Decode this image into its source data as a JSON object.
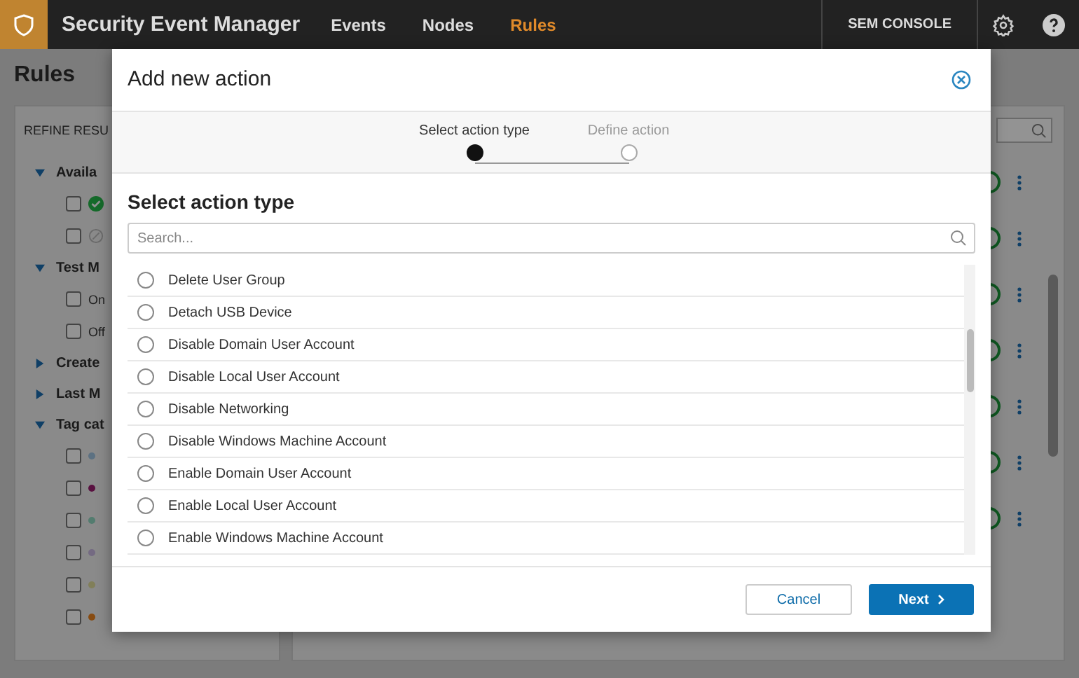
{
  "app_bar": {
    "title": "Security Event Manager",
    "nav": [
      {
        "label": "Events",
        "selected": false
      },
      {
        "label": "Nodes",
        "selected": false
      },
      {
        "label": "Rules",
        "selected": true
      }
    ],
    "console": "SEM CONSOLE"
  },
  "page": {
    "title": "Rules",
    "refine": "REFINE RESU",
    "groups": [
      {
        "label": "Availa",
        "expanded": true,
        "options": [
          {
            "kind": "status-ok",
            "checked": false
          },
          {
            "kind": "status-off",
            "checked": false
          }
        ]
      },
      {
        "label": "Test M",
        "expanded": true,
        "options": [
          {
            "label": "On",
            "kind": "plain",
            "checked": false
          },
          {
            "label": "Off",
            "kind": "plain",
            "checked": false
          }
        ]
      },
      {
        "label": "Create",
        "expanded": false
      },
      {
        "label": "Last M",
        "expanded": false
      },
      {
        "label": "Tag cat",
        "expanded": true,
        "options": [
          {
            "kind": "tag",
            "color": "#5c7182",
            "checked": false
          },
          {
            "kind": "tag",
            "color": "#591140",
            "checked": false
          },
          {
            "kind": "tag",
            "color": "#537c6f",
            "checked": false
          },
          {
            "kind": "tag",
            "color": "#746a82",
            "checked": false
          },
          {
            "kind": "tag",
            "color": "#817f59",
            "checked": false
          },
          {
            "kind": "tag",
            "color": "#874b11",
            "checked": false
          }
        ]
      }
    ],
    "rules": [
      {
        "on": true
      },
      {
        "on": true
      },
      {
        "on": true
      },
      {
        "on": true
      },
      {
        "on": true
      },
      {
        "on": true
      },
      {
        "on": true
      }
    ]
  },
  "dialog": {
    "title": "Add new action",
    "steps": [
      {
        "label": "Select action type",
        "selected": true
      },
      {
        "label": "Define action",
        "selected": false
      }
    ],
    "heading": "Select action type",
    "search": {
      "placeholder": "Search..."
    },
    "options": [
      {
        "label": "Delete User Group",
        "selected": false
      },
      {
        "label": "Detach USB Device",
        "selected": false
      },
      {
        "label": "Disable Domain User Account",
        "selected": false
      },
      {
        "label": "Disable Local User Account",
        "selected": false
      },
      {
        "label": "Disable Networking",
        "selected": false
      },
      {
        "label": "Disable Windows Machine Account",
        "selected": false
      },
      {
        "label": "Enable Domain User Account",
        "selected": false
      },
      {
        "label": "Enable Local User Account",
        "selected": false
      },
      {
        "label": "Enable Windows Machine Account",
        "selected": false
      }
    ],
    "buttons": {
      "cancel": "Cancel",
      "next": "Next"
    }
  }
}
